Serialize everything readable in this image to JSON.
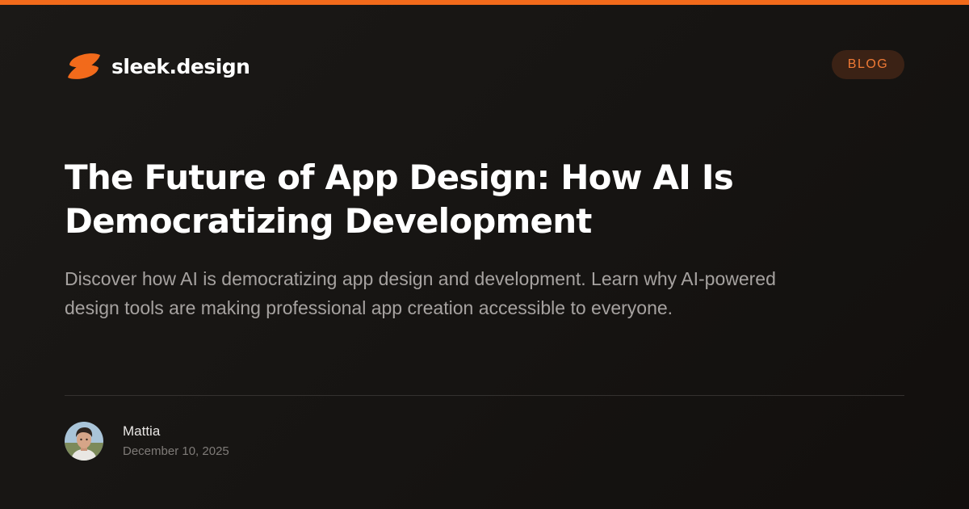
{
  "brand": {
    "name": "sleek.design",
    "logo_icon": "swirl-logo-icon",
    "accent_color": "#f26a1b"
  },
  "badge": {
    "label": "BLOG",
    "text_color": "#f07a35",
    "background": "#3b2215"
  },
  "article": {
    "title": "The Future of App Design: How AI Is Democratizing Development",
    "description": "Discover how AI is democratizing app design and development. Learn why AI-powered design tools are making professional app creation accessible to everyone."
  },
  "author": {
    "name": "Mattia",
    "date": "December 10, 2025",
    "avatar_icon": "author-avatar"
  },
  "colors": {
    "background": "#161412",
    "title": "#ffffff",
    "description": "#a6a2a0",
    "divider": "#34312f",
    "date": "#7f7b78"
  }
}
